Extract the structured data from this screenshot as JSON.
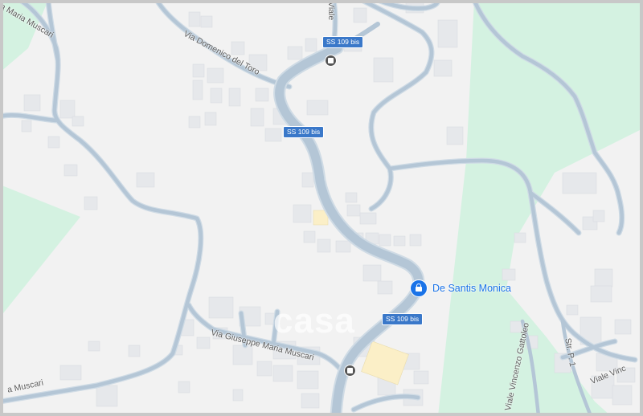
{
  "map": {
    "colors": {
      "background": "#f2f2f2",
      "green": "#d4f2e1",
      "road_fill": "#b4c6d6",
      "road_edge": "#cfdbe5",
      "building": "#e6e8eb",
      "highlight": "#fbefc7",
      "shield": "#3a78c9",
      "pin": "#1a73e8"
    },
    "street_labels": {
      "via_domenico_del_toro": "Via Domenico del Toro",
      "viale_top": "Viale",
      "via_giuseppe_maria_muscari_top": "a Maria Muscari",
      "via_giuseppe_maria_muscari_bottom": "Via Giuseppe Maria Muscari",
      "via_muscari_bottom_left": "a Muscari",
      "viale_vincenzo_gattoleo": "Viale Vincenzo Gattoleo",
      "str_p_1": "Str. P. 1",
      "viale_vinc": "Viale Vinc"
    },
    "route_shields": [
      "SS 109 bis",
      "SS 109 bis",
      "SS 109 bis"
    ],
    "poi": {
      "name": "De Santis Monica",
      "icon": "lock-bag-icon"
    },
    "transit_icons": [
      "bus-stop-icon",
      "bus-stop-icon"
    ],
    "watermark": "casa"
  }
}
